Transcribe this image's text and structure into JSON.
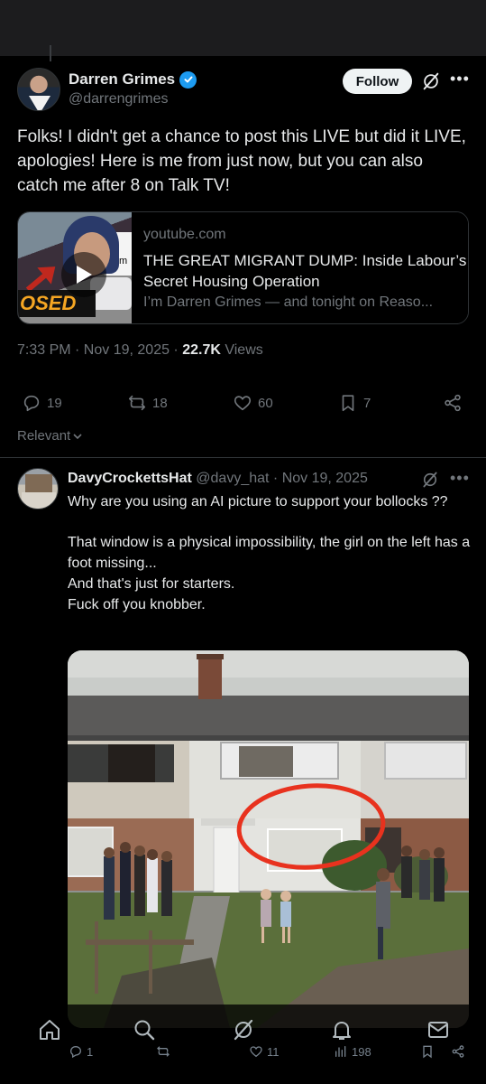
{
  "tweet": {
    "author_name": "Darren Grimes",
    "author_handle": "@darrengrimes",
    "follow_label": "Follow",
    "text": "Folks! I didn't get a chance to post this LIVE but did it LIVE, apologies! Here is me from just now, but you can also catch me after 8 on Talk TV!",
    "card": {
      "thumb_banner": "OSED",
      "thumb_sign": "Hom",
      "domain": "youtube.com",
      "title": "THE GREAT MIGRANT DUMP: Inside Labour’s Secret Housing Operation",
      "description": "I’m Darren Grimes — and tonight on Reaso..."
    },
    "time": "7:33 PM · Nov 19, 2025 · ",
    "views_count": "22.7K",
    "views_label": "Views",
    "stats": {
      "replies": "19",
      "reposts": "18",
      "likes": "60",
      "bookmarks": "7"
    }
  },
  "sort_label": "Relevant",
  "reply": {
    "author_name": "DavyCrockettsHat",
    "author_sub": " @davy_hat · Nov 19, 2025",
    "text": "Why are you using an AI picture to support your bollocks ??\n\nThat window is a physical impossibility, the girl on the left has a foot missing...\nAnd that's just for starters.\nFuck off you knobber.",
    "stats": {
      "replies": "1",
      "likes": "11",
      "views": "198"
    }
  },
  "colors": {
    "background": "#000000",
    "text_primary": "#e7e9ea",
    "text_secondary": "#71767b",
    "verified_blue": "#1d9bf0",
    "annotation_red": "#e8321e",
    "divider": "#2f3336"
  },
  "icons": [
    "verified-badge-icon",
    "grok-icon",
    "more-icon",
    "play-icon",
    "reply-icon",
    "repost-icon",
    "like-icon",
    "bookmark-icon",
    "share-icon",
    "chevron-down-icon",
    "home-icon",
    "search-icon",
    "notifications-icon",
    "messages-icon",
    "views-icon"
  ]
}
